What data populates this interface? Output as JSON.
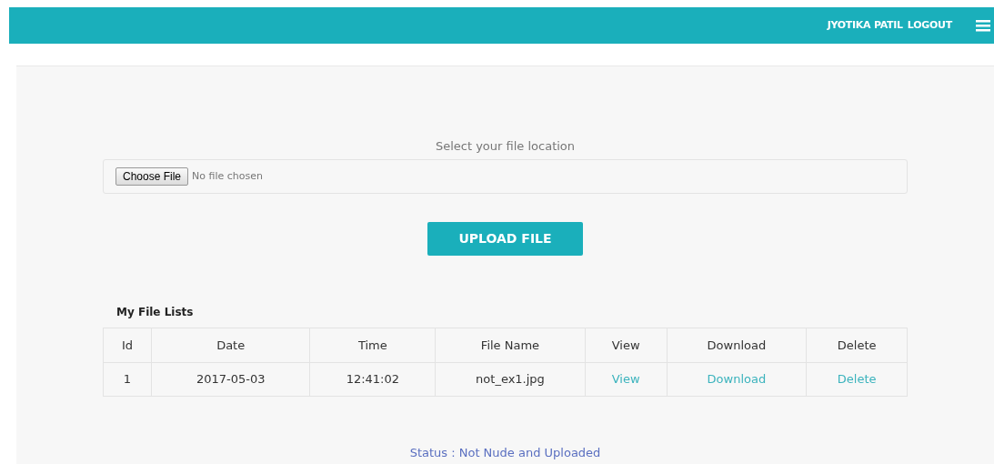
{
  "header": {
    "user": "JYOTIKA PATIL",
    "logout": "LOGOUT"
  },
  "upload": {
    "label": "Select your file location",
    "choose_button": "Choose File",
    "file_status": "No file chosen",
    "submit": "UPLOAD FILE"
  },
  "file_list": {
    "title": "My File Lists",
    "columns": [
      "Id",
      "Date",
      "Time",
      "File Name",
      "View",
      "Download",
      "Delete"
    ],
    "rows": [
      {
        "cells": [
          "1",
          "2017-05-03",
          "12:41:02",
          "not_ex1.jpg"
        ],
        "links": [
          "View",
          "Download",
          "Delete"
        ]
      }
    ]
  },
  "status": "Status : Not Nude and Uploaded"
}
